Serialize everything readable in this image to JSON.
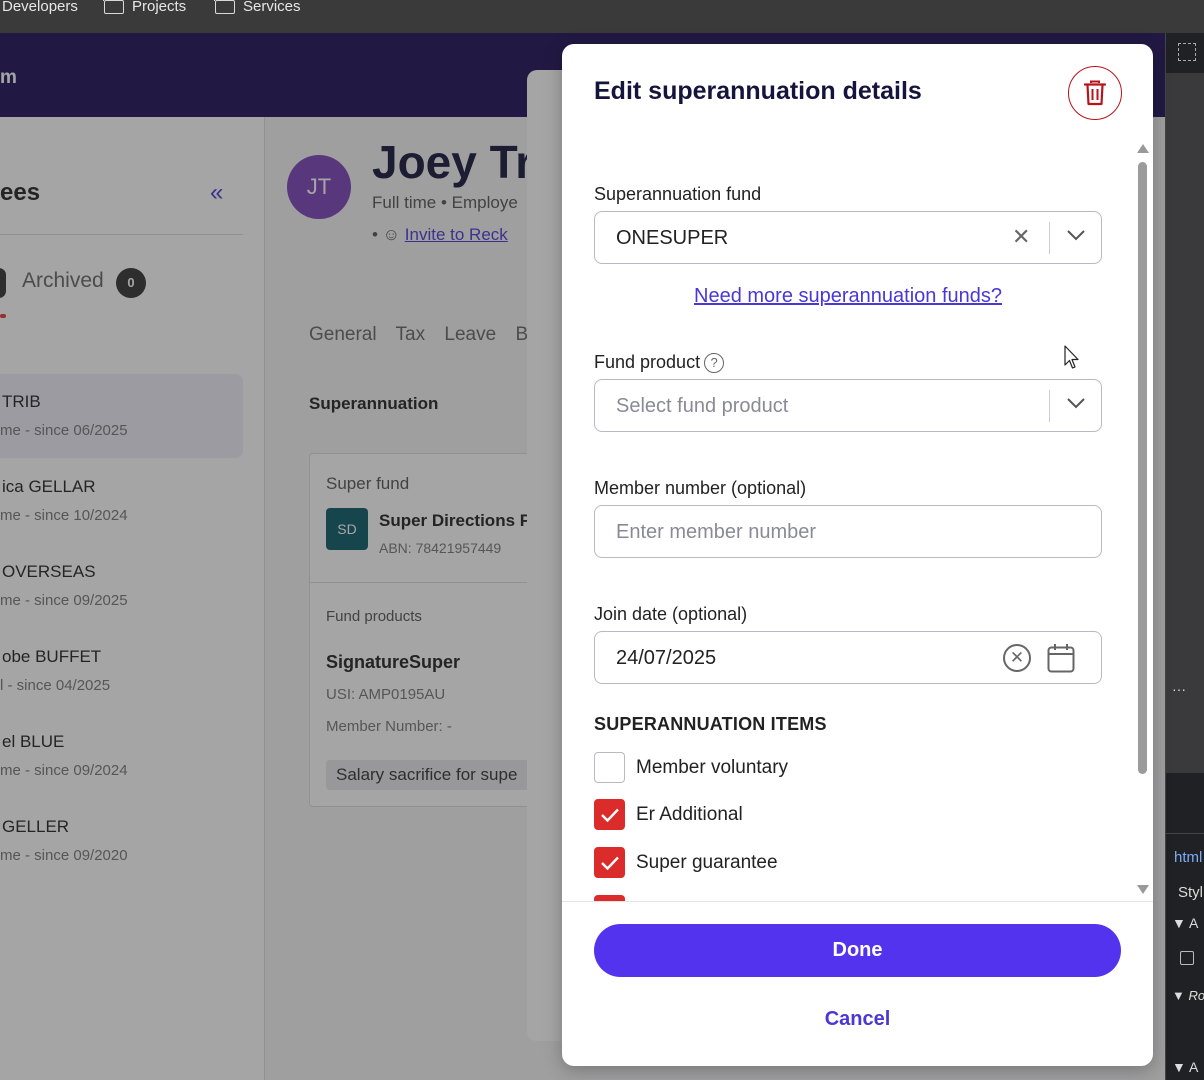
{
  "bookmarks": [
    {
      "label": "Developers"
    },
    {
      "label": "Projects"
    },
    {
      "label": "Services"
    }
  ],
  "appbar": {
    "brand_fragment": "m"
  },
  "left_panel": {
    "title_fragment": "ees",
    "collapse_glyph": "«",
    "archived_label": "Archived",
    "archived_count": "0",
    "employees": [
      {
        "name": "TRIB",
        "status": "me - since 06/2025",
        "active": true
      },
      {
        "name": "ica GELLAR",
        "status": "me - since 10/2024"
      },
      {
        "name": "OVERSEAS",
        "status": "me - since 09/2025"
      },
      {
        "name": "obe BUFFET",
        "status": "l - since 04/2025"
      },
      {
        "name": "el BLUE",
        "status": "me - since 09/2024"
      },
      {
        "name": "GELLER",
        "status": "me - since 09/2020"
      }
    ]
  },
  "employee": {
    "initials": "JT",
    "name_fragment": "Joey Tr",
    "subtitle": "Full time • Employe",
    "invite_prefix": "• ☺",
    "invite_link": "Invite to Reck",
    "tabs": [
      "General",
      "Tax",
      "Leave",
      "B"
    ],
    "section_title": "Superannuation",
    "super_card": {
      "label": "Super fund",
      "fund_initials": "SD",
      "fund_name": "Super Directions F",
      "abn": "ABN: 78421957449",
      "products_label": "Fund products",
      "product_name": "SignatureSuper",
      "usi": "USI: AMP0195AU",
      "member_number": "Member Number: -",
      "chip": "Salary sacrifice for supe"
    }
  },
  "modal": {
    "title": "Edit superannuation details",
    "fund_label": "Superannuation fund",
    "fund_value": "ONESUPER",
    "more_funds_link": "Need more superannuation funds?",
    "product_label": "Fund product",
    "product_placeholder": "Select fund product",
    "member_label": "Member number (optional)",
    "member_placeholder": "Enter member number",
    "join_label": "Join date (optional)",
    "join_value": "24/07/2025",
    "items_heading": "SUPERANNUATION ITEMS",
    "items": [
      {
        "label": "Member voluntary",
        "checked": false
      },
      {
        "label": "Er Additional",
        "checked": true
      },
      {
        "label": "Super guarantee",
        "checked": true
      }
    ],
    "done_label": "Done",
    "cancel_label": "Cancel"
  },
  "devtools": {
    "html_fragment": "html",
    "styles_fragment": "Styl",
    "row_a": "A",
    "row_ro": "Ro",
    "row_a2": "A",
    "dots": "···"
  },
  "colors": {
    "brand_dark": "#1c0f57",
    "accent": "#5433ee",
    "checkbox_on": "#dc2b2b",
    "danger": "#b8131c"
  }
}
